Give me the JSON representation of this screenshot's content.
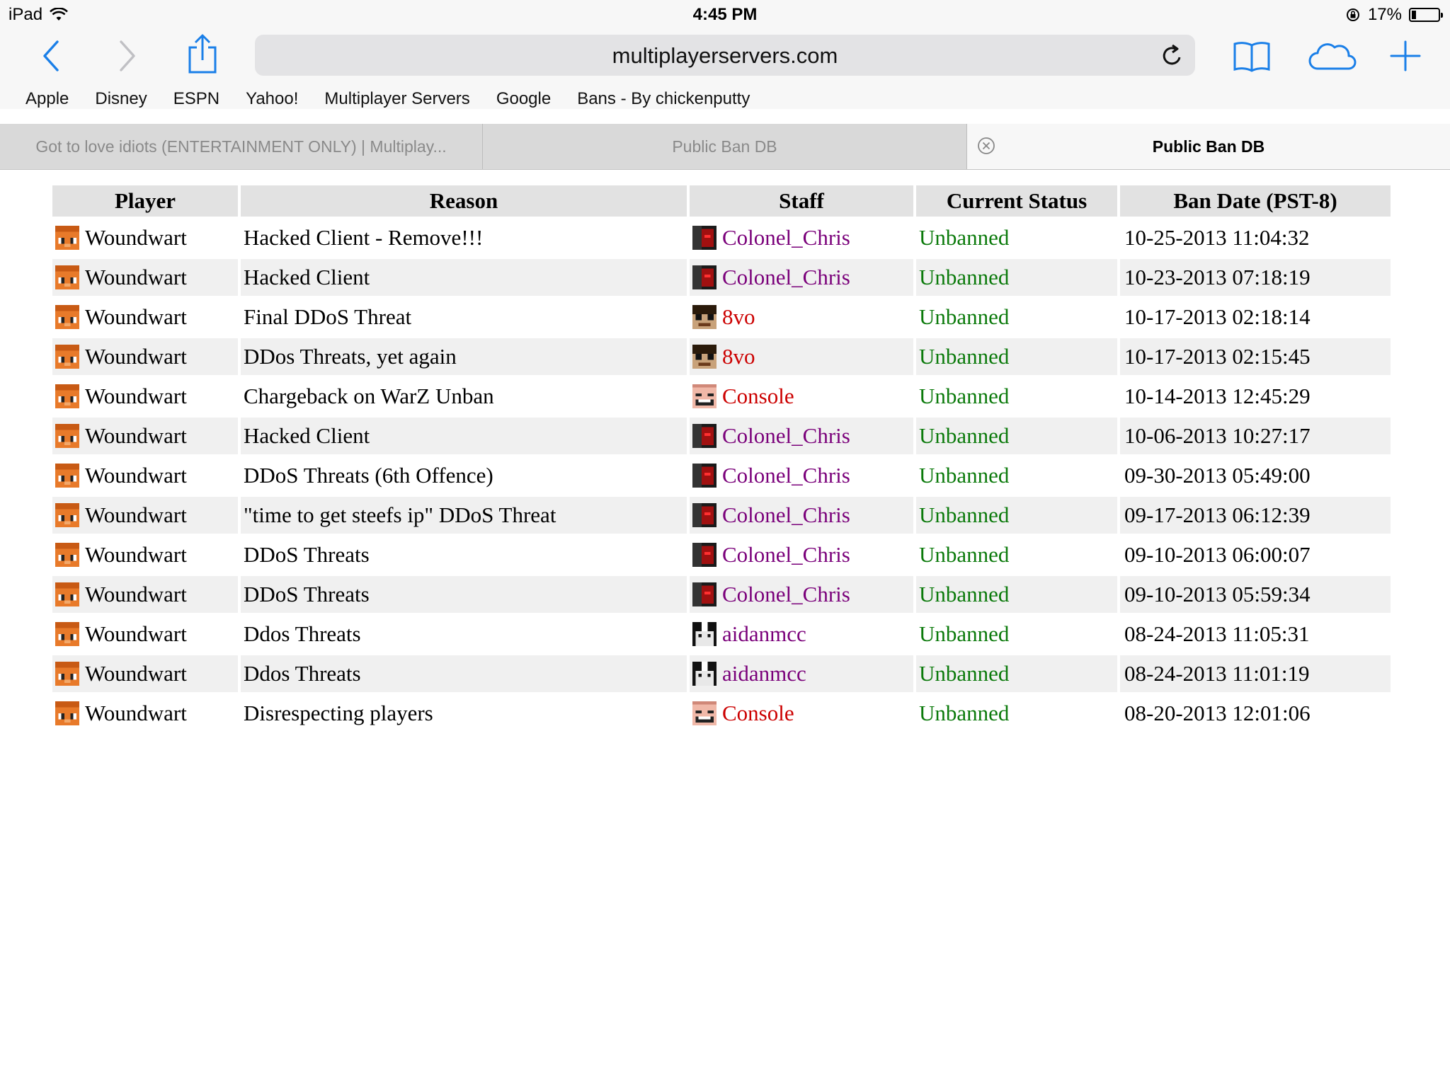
{
  "status_bar": {
    "device": "iPad",
    "time": "4:45 PM",
    "battery": "17%",
    "battery_level": 0.17
  },
  "toolbar": {
    "url": "multiplayerservers.com",
    "icons": [
      "back-icon",
      "forward-icon",
      "share-icon",
      "reload-icon",
      "bookmarks-icon",
      "icloud-tabs-icon",
      "new-tab-icon"
    ]
  },
  "bookmarks": [
    "Apple",
    "Disney",
    "ESPN",
    "Yahoo!",
    "Multiplayer Servers",
    "Google",
    "Bans - By chickenputty"
  ],
  "tabs": [
    {
      "label": "Got to love idiots (ENTERTAINMENT ONLY) | Multiplay...",
      "active": false
    },
    {
      "label": "Public Ban DB",
      "active": false
    },
    {
      "label": "Public Ban DB",
      "active": true
    }
  ],
  "table": {
    "headers": [
      "Player",
      "Reason",
      "Staff",
      "Current Status",
      "Ban Date (PST-8)"
    ],
    "rows": [
      {
        "player": "Woundwart",
        "reason": "Hacked Client - Remove!!!",
        "staff": "Colonel_Chris",
        "status": "Unbanned",
        "date": "10-25-2013 11:04:32"
      },
      {
        "player": "Woundwart",
        "reason": "Hacked Client",
        "staff": "Colonel_Chris",
        "status": "Unbanned",
        "date": "10-23-2013 07:18:19"
      },
      {
        "player": "Woundwart",
        "reason": "Final DDoS Threat",
        "staff": "8vo",
        "status": "Unbanned",
        "date": "10-17-2013 02:18:14"
      },
      {
        "player": "Woundwart",
        "reason": "DDos Threats, yet again",
        "staff": "8vo",
        "status": "Unbanned",
        "date": "10-17-2013 02:15:45"
      },
      {
        "player": "Woundwart",
        "reason": "Chargeback on WarZ Unban",
        "staff": "Console",
        "status": "Unbanned",
        "date": "10-14-2013 12:45:29"
      },
      {
        "player": "Woundwart",
        "reason": "Hacked Client",
        "staff": "Colonel_Chris",
        "status": "Unbanned",
        "date": "10-06-2013 10:27:17"
      },
      {
        "player": "Woundwart",
        "reason": "DDoS Threats (6th Offence)",
        "staff": "Colonel_Chris",
        "status": "Unbanned",
        "date": "09-30-2013 05:49:00"
      },
      {
        "player": "Woundwart",
        "reason": "\"time to get steefs ip\" DDoS Threat",
        "staff": "Colonel_Chris",
        "status": "Unbanned",
        "date": "09-17-2013 06:12:39"
      },
      {
        "player": "Woundwart",
        "reason": "DDoS Threats",
        "staff": "Colonel_Chris",
        "status": "Unbanned",
        "date": "09-10-2013 06:00:07"
      },
      {
        "player": "Woundwart",
        "reason": "DDoS Threats",
        "staff": "Colonel_Chris",
        "status": "Unbanned",
        "date": "09-10-2013 05:59:34"
      },
      {
        "player": "Woundwart",
        "reason": "Ddos Threats",
        "staff": "aidanmcc",
        "status": "Unbanned",
        "date": "08-24-2013 11:05:31"
      },
      {
        "player": "Woundwart",
        "reason": "Ddos Threats",
        "staff": "aidanmcc",
        "status": "Unbanned",
        "date": "08-24-2013 11:01:19"
      },
      {
        "player": "Woundwart",
        "reason": "Disrespecting players",
        "staff": "Console",
        "status": "Unbanned",
        "date": "08-20-2013 12:01:06"
      }
    ]
  },
  "colors": {
    "accent": "#1a7fe8",
    "staff_purple": "#7a007a",
    "staff_red": "#cc0000",
    "status_green": "#0b7a0b"
  }
}
